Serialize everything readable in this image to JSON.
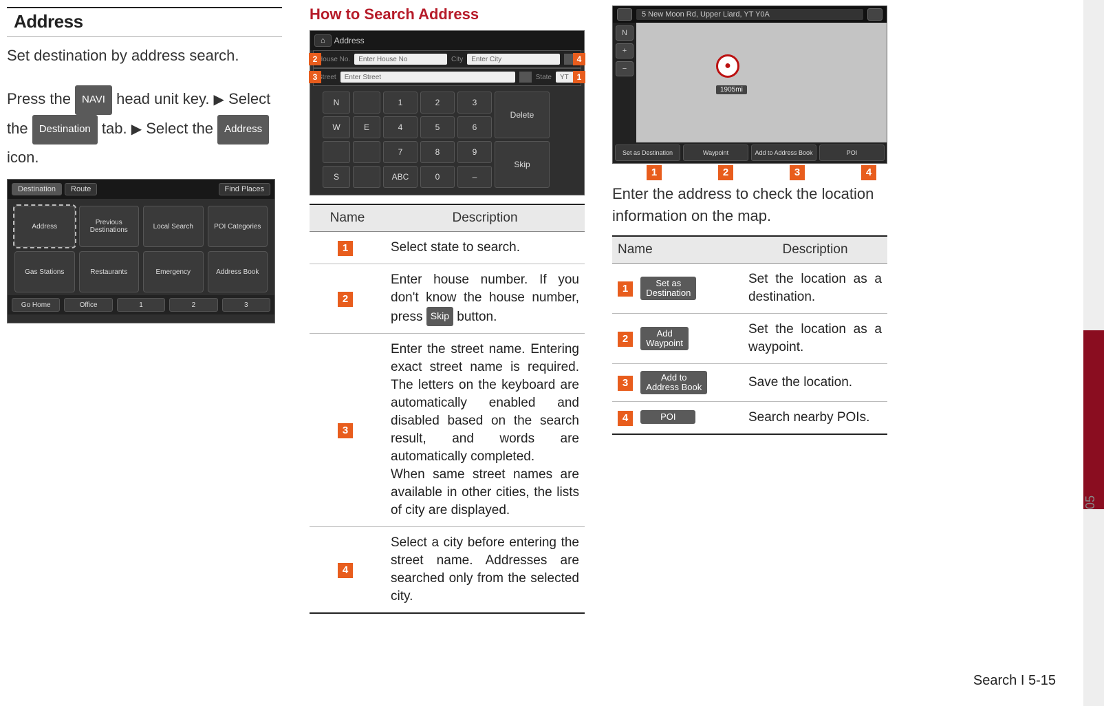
{
  "sideTab": "05",
  "footer": "Search I 5-15",
  "col1": {
    "heading": "Address",
    "intro": "Set destination by address search.",
    "step_pre": "Press the ",
    "btn_navi": "NAVI",
    "step_mid1": " head unit key. ",
    "arrow": "▶",
    "step_mid2": " Select the ",
    "btn_dest": "Destination",
    "step_mid3": " tab. ",
    "step_mid4": " Select the ",
    "btn_addr": "Address",
    "step_end": " icon.",
    "shot": {
      "tabs": [
        "Destination",
        "Route",
        "Find Places"
      ],
      "icons": [
        "Address",
        "Previous Destinations",
        "Local Search",
        "POI Categories",
        "Gas Stations",
        "Restaurants",
        "Emergency",
        "Address Book"
      ],
      "bottom": [
        "Go Home",
        "Office",
        "1",
        "2",
        "3"
      ]
    }
  },
  "col2": {
    "heading": "How to Search Address",
    "shot": {
      "title": "Address",
      "house_lbl": "House No.",
      "house_ph": "Enter House No",
      "city_lbl": "City",
      "city_ph": "Enter City",
      "street_lbl": "Street",
      "street_ph": "Enter Street",
      "state_lbl": "State",
      "state_val": "YT",
      "keys": [
        "N",
        "1",
        "2",
        "3",
        "Delete",
        "W",
        "E",
        "4",
        "5",
        "6",
        "7",
        "8",
        "9",
        "Skip",
        "S",
        "ABC",
        "0",
        "–"
      ]
    },
    "callouts": {
      "topL": "2",
      "topR": "4",
      "botL": "3",
      "botR": "1"
    },
    "table": {
      "head_name": "Name",
      "head_desc": "Description",
      "rows": [
        {
          "n": "1",
          "d": "Select state to search."
        },
        {
          "n": "2",
          "d_pre": "Enter house number. If you don't know the house number, press ",
          "btn": "Skip",
          "d_post": " button."
        },
        {
          "n": "3",
          "d": "Enter the street name. Entering exact street name is required. The letters on the keyboard are automatically enabled and disabled based on the search result, and words are automatically completed.\nWhen same street names are available in other cities, the lists of city are displayed."
        },
        {
          "n": "4",
          "d": "Select a city before entering the street name. Addresses are searched only from the selected city."
        }
      ]
    }
  },
  "col3": {
    "shot": {
      "addr": "5 New Moon Rd, Upper Liard, YT Y0A",
      "dist": "1905mi",
      "side": [
        "N",
        "+",
        "−"
      ],
      "bottom": [
        "Set as Destination",
        "Waypoint",
        "Add to Address Book",
        "POI"
      ]
    },
    "callouts": [
      "1",
      "2",
      "3",
      "4"
    ],
    "caption": "Enter the address to check the location information on the map.",
    "table": {
      "head_name": "Name",
      "head_desc": "Description",
      "rows": [
        {
          "n": "1",
          "btn": "Set as\nDestination",
          "d": "Set the location as a destination."
        },
        {
          "n": "2",
          "btn": "Add\nWaypoint",
          "d": "Set the location as a waypoint."
        },
        {
          "n": "3",
          "btn": "Add to\nAddress Book",
          "d": "Save the location."
        },
        {
          "n": "4",
          "btn": "POI",
          "d": "Search nearby POIs."
        }
      ]
    }
  }
}
